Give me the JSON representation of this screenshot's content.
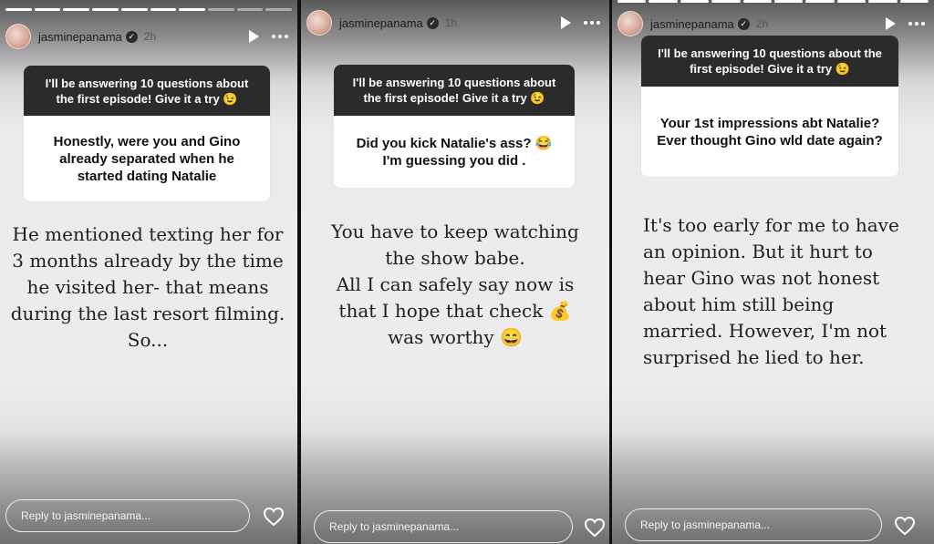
{
  "stories": [
    {
      "username": "jasminepanama",
      "time": "2h",
      "progress_segments": 10,
      "progress_done": 7,
      "question_header": "I'll be answering 10 questions about the first episode! Give it a try 😉",
      "question": "Honestly, were you and Gino already separated when he started dating Natalie",
      "answer": "He mentioned  texting her for 3 months already by the time he visited her- that means during the last resort filming.\nSo...",
      "reply_placeholder": "Reply to jasminepanama..."
    },
    {
      "username": "jasminepanama",
      "time": "1h",
      "question_header": "I'll be answering 10 questions about the first episode! Give it a try 😉",
      "question": "Did you kick Natalie's ass? 😂\nI'm guessing you did .",
      "answer": "You have to keep watching the show babe.\nAll I can safely say now is that I hope that check 💰\nwas worthy 😄",
      "reply_placeholder": "Reply to jasminepanama..."
    },
    {
      "username": "jasminepanama",
      "time": "2h",
      "progress_segments": 10,
      "progress_done": 10,
      "question_header": "I'll be answering 10 questions about the first episode! Give it a try 😉",
      "question": "Your 1st impressions abt Natalie? Ever thought Gino wld date again?",
      "answer": "It's too early for me to have an opinion. But it hurt to hear Gino was not honest about him still being married. However, I'm not surprised he lied to her.",
      "reply_placeholder": "Reply to jasminepanama..."
    }
  ],
  "colors": {
    "question_header_bg": "#2b2b2b",
    "card_bg": "#ffffff",
    "answer_text": "#1e1e1e"
  }
}
